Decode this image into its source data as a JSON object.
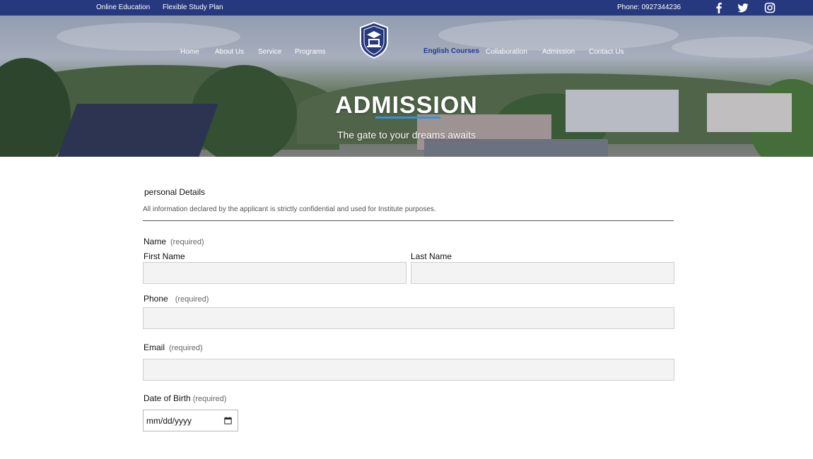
{
  "topbar": {
    "online_education": "Online Education",
    "flexible_study": "Flexible Study Plan",
    "phone": "Phone:  0927344236"
  },
  "nav": {
    "left": [
      "Home",
      "About Us",
      "Service",
      "Programs"
    ],
    "right": [
      "English Courses",
      "Collaboration",
      "Admission",
      "Contact Us"
    ],
    "active": "English Courses"
  },
  "hero": {
    "title": "ADMISSION",
    "subtitle": "The gate to your dreams awaits"
  },
  "form": {
    "section_title": "personal Details",
    "section_note": "All information declared by the applicant is strictly confidential and used for Institute purposes.",
    "name_label": "Name",
    "required": "(required)",
    "first_name_label": "First Name",
    "last_name_label": "Last Name",
    "phone_label": "Phone",
    "email_label": "Email",
    "dob_label": "Date of Birth",
    "dob_placeholder": "mm/dd/yyyy"
  },
  "colors": {
    "topbar": "#26387e",
    "accent": "#3b8fd6",
    "input_bg": "#f3f3f3"
  },
  "icons": [
    "facebook-icon",
    "twitter-icon",
    "instagram-icon",
    "school-logo-icon",
    "calendar-icon"
  ]
}
